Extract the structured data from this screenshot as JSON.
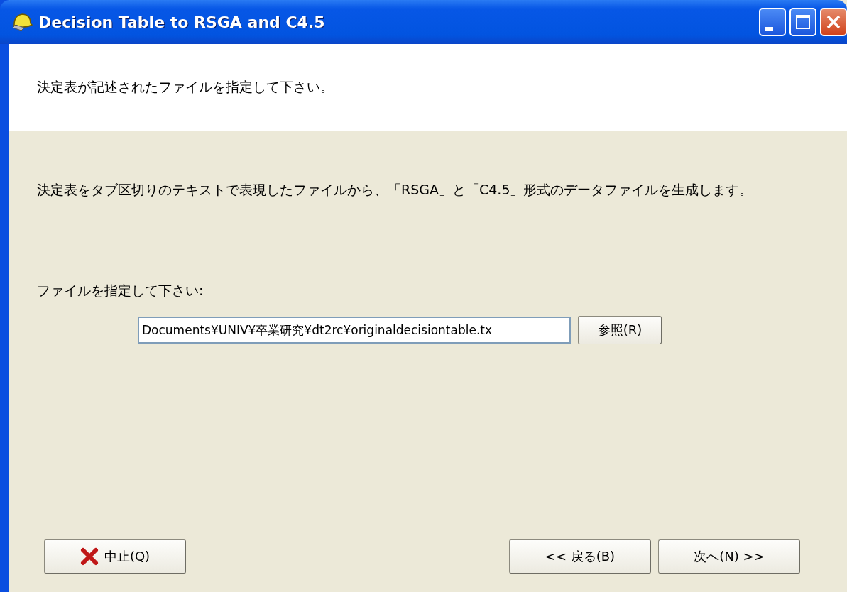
{
  "window": {
    "title": "Decision Table to RSGA and C4.5"
  },
  "header": {
    "instruction": "決定表が記述されたファイルを指定して下さい。"
  },
  "body": {
    "description": "決定表をタブ区切りのテキストで表現したファイルから、「RSGA」と「C4.5」形式のデータファイルを生成します。",
    "file_label": "ファイルを指定して下さい:",
    "file_field": {
      "value": "Documents¥UNIV¥卒業研究¥dt2rc¥originaldecisiontable.tx"
    },
    "browse_button": "参照(R)"
  },
  "buttons": [
    {
      "kind": "cancel",
      "label": "中止(Q)"
    },
    {
      "kind": "back",
      "label": "<< 戻る(B)"
    },
    {
      "kind": "next",
      "label": "次へ(N) >>"
    }
  ]
}
